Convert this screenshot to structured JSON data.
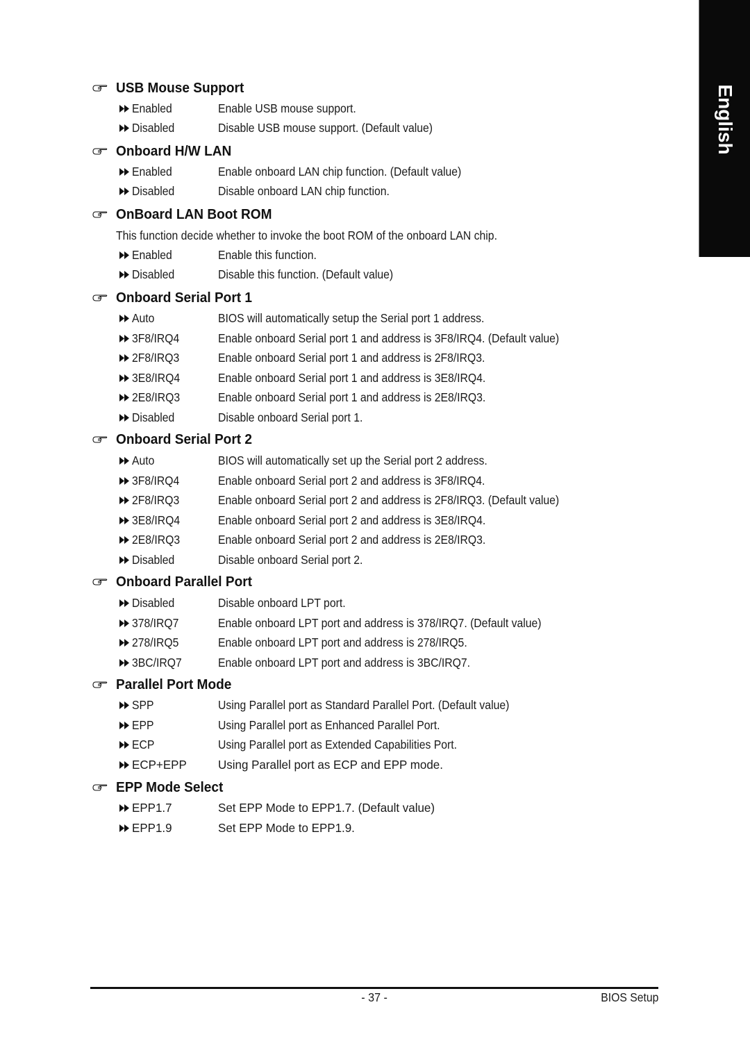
{
  "side_tab": {
    "label": "English"
  },
  "sections": [
    {
      "title": "USB Mouse Support",
      "icon": "pointing-hand-icon",
      "options": [
        {
          "label": "Enabled",
          "description": "Enable USB mouse support."
        },
        {
          "label": "Disabled",
          "description": "Disable USB mouse support. (Default value)"
        }
      ]
    },
    {
      "title": "Onboard H/W LAN",
      "icon": "pointing-hand-icon",
      "options": [
        {
          "label": "Enabled",
          "description": "Enable onboard LAN chip function. (Default value)"
        },
        {
          "label": "Disabled",
          "description": "Disable onboard LAN chip function."
        }
      ]
    },
    {
      "title": "OnBoard LAN Boot ROM",
      "icon": "pointing-hand-icon",
      "intro": "This function decide whether to invoke the boot ROM of the onboard LAN chip.",
      "options": [
        {
          "label": "Enabled",
          "description": "Enable this function."
        },
        {
          "label": "Disabled",
          "description": "Disable this function. (Default value)"
        }
      ]
    },
    {
      "title": "Onboard Serial Port 1",
      "icon": "pointing-hand-icon",
      "options": [
        {
          "label": "Auto",
          "description": "BIOS will automatically setup the Serial port 1 address."
        },
        {
          "label": "3F8/IRQ4",
          "description": "Enable onboard Serial port 1 and address is 3F8/IRQ4. (Default value)"
        },
        {
          "label": "2F8/IRQ3",
          "description": "Enable onboard Serial port 1 and address is 2F8/IRQ3."
        },
        {
          "label": "3E8/IRQ4",
          "description": "Enable onboard Serial port 1 and address is 3E8/IRQ4."
        },
        {
          "label": "2E8/IRQ3",
          "description": "Enable onboard Serial port 1 and address is 2E8/IRQ3."
        },
        {
          "label": "Disabled",
          "description": "Disable onboard Serial port 1."
        }
      ]
    },
    {
      "title": "Onboard Serial Port 2",
      "icon": "pointing-hand-icon",
      "options": [
        {
          "label": "Auto",
          "description": "BIOS will automatically set up the  Serial port 2 address."
        },
        {
          "label": "3F8/IRQ4",
          "description": "Enable onboard Serial port 2 and address is 3F8/IRQ4."
        },
        {
          "label": "2F8/IRQ3",
          "description": "Enable onboard Serial port 2 and address is 2F8/IRQ3. (Default value)"
        },
        {
          "label": "3E8/IRQ4",
          "description": "Enable onboard Serial port 2 and address is 3E8/IRQ4."
        },
        {
          "label": "2E8/IRQ3",
          "description": "Enable onboard Serial port 2 and address is 2E8/IRQ3."
        },
        {
          "label": "Disabled",
          "description": "Disable onboard Serial port 2."
        }
      ]
    },
    {
      "title": "Onboard Parallel Port",
      "icon": "pointing-hand-icon",
      "options": [
        {
          "label": "Disabled",
          "description": "Disable onboard LPT port."
        },
        {
          "label": "378/IRQ7",
          "description": "Enable onboard LPT port and address is 378/IRQ7. (Default value)"
        },
        {
          "label": "278/IRQ5",
          "description": "Enable onboard LPT port and address is 278/IRQ5."
        },
        {
          "label": "3BC/IRQ7",
          "description": "Enable onboard LPT port and address is 3BC/IRQ7."
        }
      ]
    },
    {
      "title": "Parallel Port Mode",
      "icon": "pointing-hand-icon",
      "options": [
        {
          "label": "SPP",
          "description": "Using Parallel port as Standard Parallel Port. (Default value)"
        },
        {
          "label": "EPP",
          "description": "Using Parallel port as Enhanced Parallel Port."
        },
        {
          "label": "ECP",
          "description": "Using Parallel port as Extended Capabilities Port."
        },
        {
          "label": "ECP+EPP",
          "description": "Using Parallel port as ECP and EPP mode."
        }
      ]
    },
    {
      "title": "EPP Mode Select",
      "icon": "pointing-hand-icon",
      "options": [
        {
          "label": "EPP1.7",
          "description": "Set EPP Mode to EPP1.7. (Default value)"
        },
        {
          "label": "EPP1.9",
          "description": "Set EPP Mode to EPP1.9."
        }
      ]
    }
  ],
  "footer": {
    "page_number": "- 37 -",
    "title": "BIOS Setup"
  }
}
